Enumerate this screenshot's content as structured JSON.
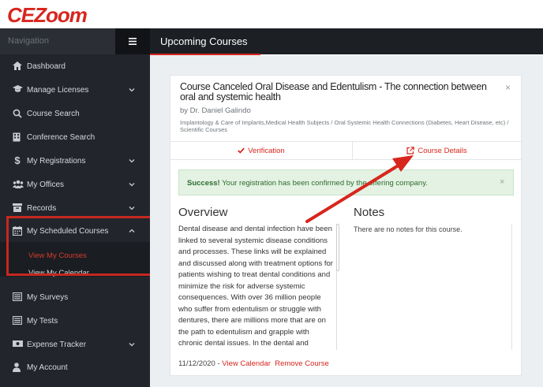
{
  "brand": {
    "logo_prefix": "CE",
    "logo_suffix": "Zoom"
  },
  "sidebar": {
    "header": "Navigation",
    "items": [
      {
        "label": "Dashboard"
      },
      {
        "label": "Manage Licenses"
      },
      {
        "label": "Course Search"
      },
      {
        "label": "Conference Search"
      },
      {
        "label": "My Registrations"
      },
      {
        "label": "My Offices"
      },
      {
        "label": "Records"
      },
      {
        "label": "My Scheduled Courses"
      },
      {
        "label": "My Surveys"
      },
      {
        "label": "My Tests"
      },
      {
        "label": "Expense Tracker"
      },
      {
        "label": "My Account"
      }
    ],
    "sub_items": [
      {
        "label": "View My Courses"
      },
      {
        "label": "View My Calendar"
      }
    ]
  },
  "header": {
    "title": "Upcoming Courses"
  },
  "course": {
    "title": "Course Canceled Oral Disease and Edentulism - The connection between oral and systemic health",
    "author": "by Dr. Daniel Galindo",
    "categories": "Implantology & Care of Implants,Medical Health Subjects / Oral Systemic Health Connections (Diabetes, Heart Disease, etc) / Scientific Courses",
    "close": "×"
  },
  "tabs": {
    "verification": "Verification",
    "details": "Course Details"
  },
  "alert": {
    "strong": "Success!",
    "message": " Your registration has been confirmed by the offering company.",
    "close": "×"
  },
  "overview": {
    "heading": "Overview",
    "text": "Dental disease and dental infection have been linked to several systemic disease conditions and processes. These links will be explained and discussed along with treatment options for patients wishing to treat dental conditions and minimize the risk for adverse systemic consequences. With over 36 million people who suffer from edentulism or struggle with dentures, there are millions more that are on the path to edentulism and grapple with chronic dental issues. In the dental and medical community, there are unique opportunities to"
  },
  "notes": {
    "heading": "Notes",
    "text": "There are no notes for this course."
  },
  "footer": {
    "date": "11/12/2020 - ",
    "view_calendar": "View Calendar",
    "remove_course": "Remove Course"
  },
  "colors": {
    "accent": "#d7261e",
    "sidebar": "#22262c",
    "success_bg": "#e3f2e3"
  }
}
